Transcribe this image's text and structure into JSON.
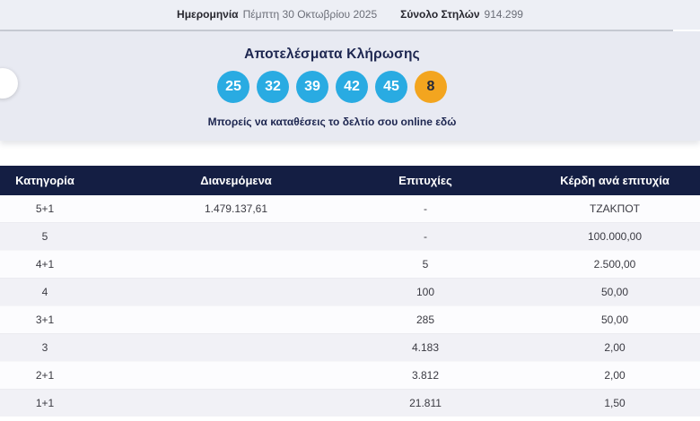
{
  "colors": {
    "topbar_bg": "#edeff5",
    "panel_bg": "#e8eaf2",
    "header_navy": "#141e43",
    "navy_text": "#1d2650",
    "ball_blue": "#29abe2",
    "ball_orange": "#f3a51f",
    "joker_text": "#23293a"
  },
  "topbar": {
    "date_label": "Ημερομηνία",
    "date_value": "Πέμπτη 30 Οκτωβρίου 2025",
    "columns_label": "Σύνολο Στηλών",
    "columns_value": "914.299"
  },
  "results": {
    "title": "Αποτελέσματα Κλήρωσης",
    "numbers": [
      "25",
      "32",
      "39",
      "42",
      "45"
    ],
    "joker": "8",
    "cta_text": "Μπορείς να καταθέσεις το δελτίο σου online",
    "cta_link": "εδώ"
  },
  "table": {
    "headers": [
      "Κατηγορία",
      "Διανεμόμενα",
      "Επιτυχίες",
      "Κέρδη ανά επιτυχία"
    ],
    "rows": [
      [
        "5+1",
        "1.479.137,61",
        "-",
        "ΤΖΑΚΠΟΤ"
      ],
      [
        "5",
        "",
        "-",
        "100.000,00"
      ],
      [
        "4+1",
        "",
        "5",
        "2.500,00"
      ],
      [
        "4",
        "",
        "100",
        "50,00"
      ],
      [
        "3+1",
        "",
        "285",
        "50,00"
      ],
      [
        "3",
        "",
        "4.183",
        "2,00"
      ],
      [
        "2+1",
        "",
        "3.812",
        "2,00"
      ],
      [
        "1+1",
        "",
        "21.811",
        "1,50"
      ]
    ]
  }
}
